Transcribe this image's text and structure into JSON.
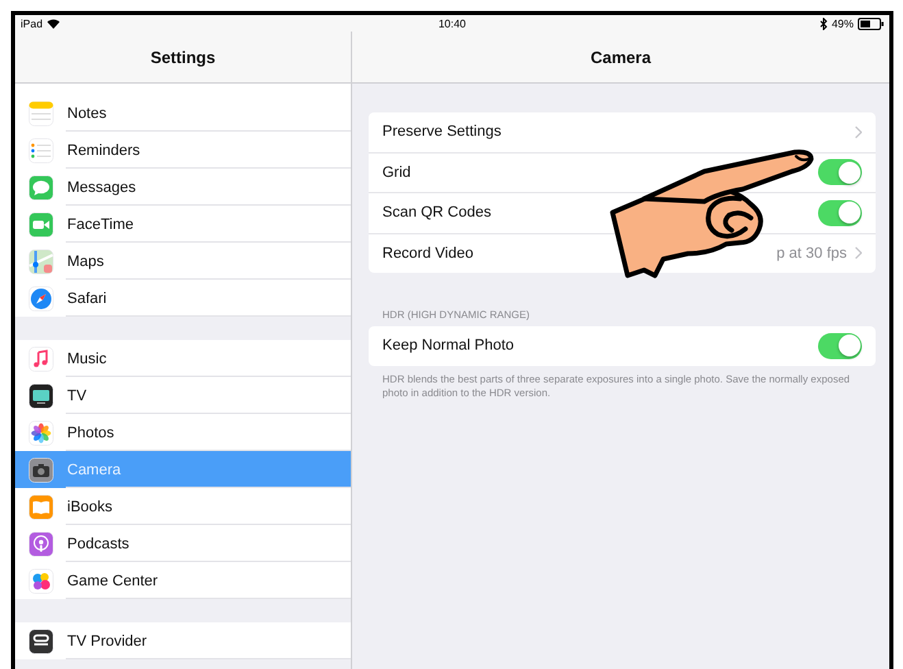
{
  "status_bar": {
    "device": "iPad",
    "time": "10:40",
    "battery": "49%"
  },
  "sidebar": {
    "title": "Settings",
    "groups": [
      {
        "items": [
          {
            "label": "Notes",
            "selected": false
          },
          {
            "label": "Reminders",
            "selected": false
          },
          {
            "label": "Messages",
            "selected": false
          },
          {
            "label": "FaceTime",
            "selected": false
          },
          {
            "label": "Maps",
            "selected": false
          },
          {
            "label": "Safari",
            "selected": false
          }
        ]
      },
      {
        "items": [
          {
            "label": "Music",
            "selected": false
          },
          {
            "label": "TV",
            "selected": false
          },
          {
            "label": "Photos",
            "selected": false
          },
          {
            "label": "Camera",
            "selected": true
          },
          {
            "label": "iBooks",
            "selected": false
          },
          {
            "label": "Podcasts",
            "selected": false
          },
          {
            "label": "Game Center",
            "selected": false
          }
        ]
      },
      {
        "items": [
          {
            "label": "TV Provider",
            "selected": false
          }
        ]
      }
    ]
  },
  "detail": {
    "title": "Camera",
    "sections": [
      {
        "rows": [
          {
            "kind": "chevron",
            "label": "Preserve Settings"
          },
          {
            "kind": "toggle",
            "label": "Grid",
            "on": true
          },
          {
            "kind": "toggle",
            "label": "Scan QR Codes",
            "on": true
          },
          {
            "kind": "value",
            "label": "Record Video",
            "value": "p at 30 fps"
          }
        ]
      },
      {
        "header": "HDR (HIGH DYNAMIC RANGE)",
        "rows": [
          {
            "kind": "toggle",
            "label": "Keep Normal Photo",
            "on": true
          }
        ],
        "footer": "HDR blends the best parts of three separate exposures into a single photo. Save the normally exposed photo in addition to the HDR version."
      }
    ]
  }
}
